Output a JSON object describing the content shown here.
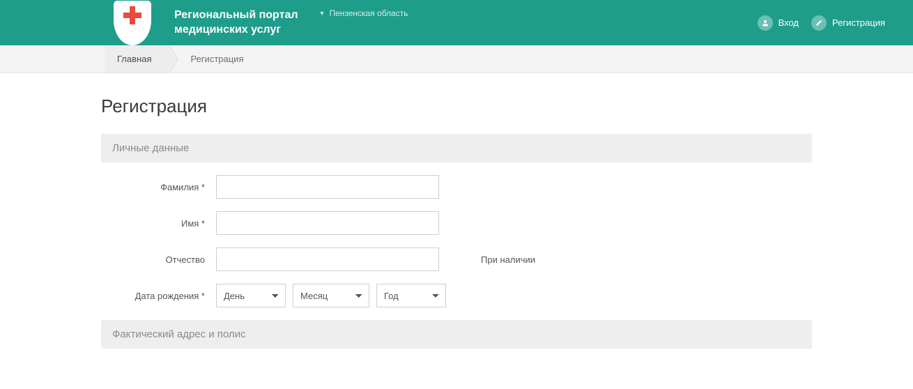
{
  "header": {
    "brand_line1": "Региональный портал",
    "brand_line2": "медицинских услуг",
    "region": "Пензенская область",
    "login": "Вход",
    "register": "Регистрация"
  },
  "breadcrumb": {
    "home": "Главная",
    "current": "Регистрация"
  },
  "page": {
    "title": "Регистрация"
  },
  "sections": {
    "personal": "Личные данные",
    "address": "Фактический адрес и полис"
  },
  "form": {
    "surname_label": "Фамилия *",
    "name_label": "Имя *",
    "patronymic_label": "Отчество",
    "patronymic_hint": "При наличии",
    "dob_label": "Дата рождения *",
    "day_placeholder": "День",
    "month_placeholder": "Месяц",
    "year_placeholder": "Год"
  }
}
